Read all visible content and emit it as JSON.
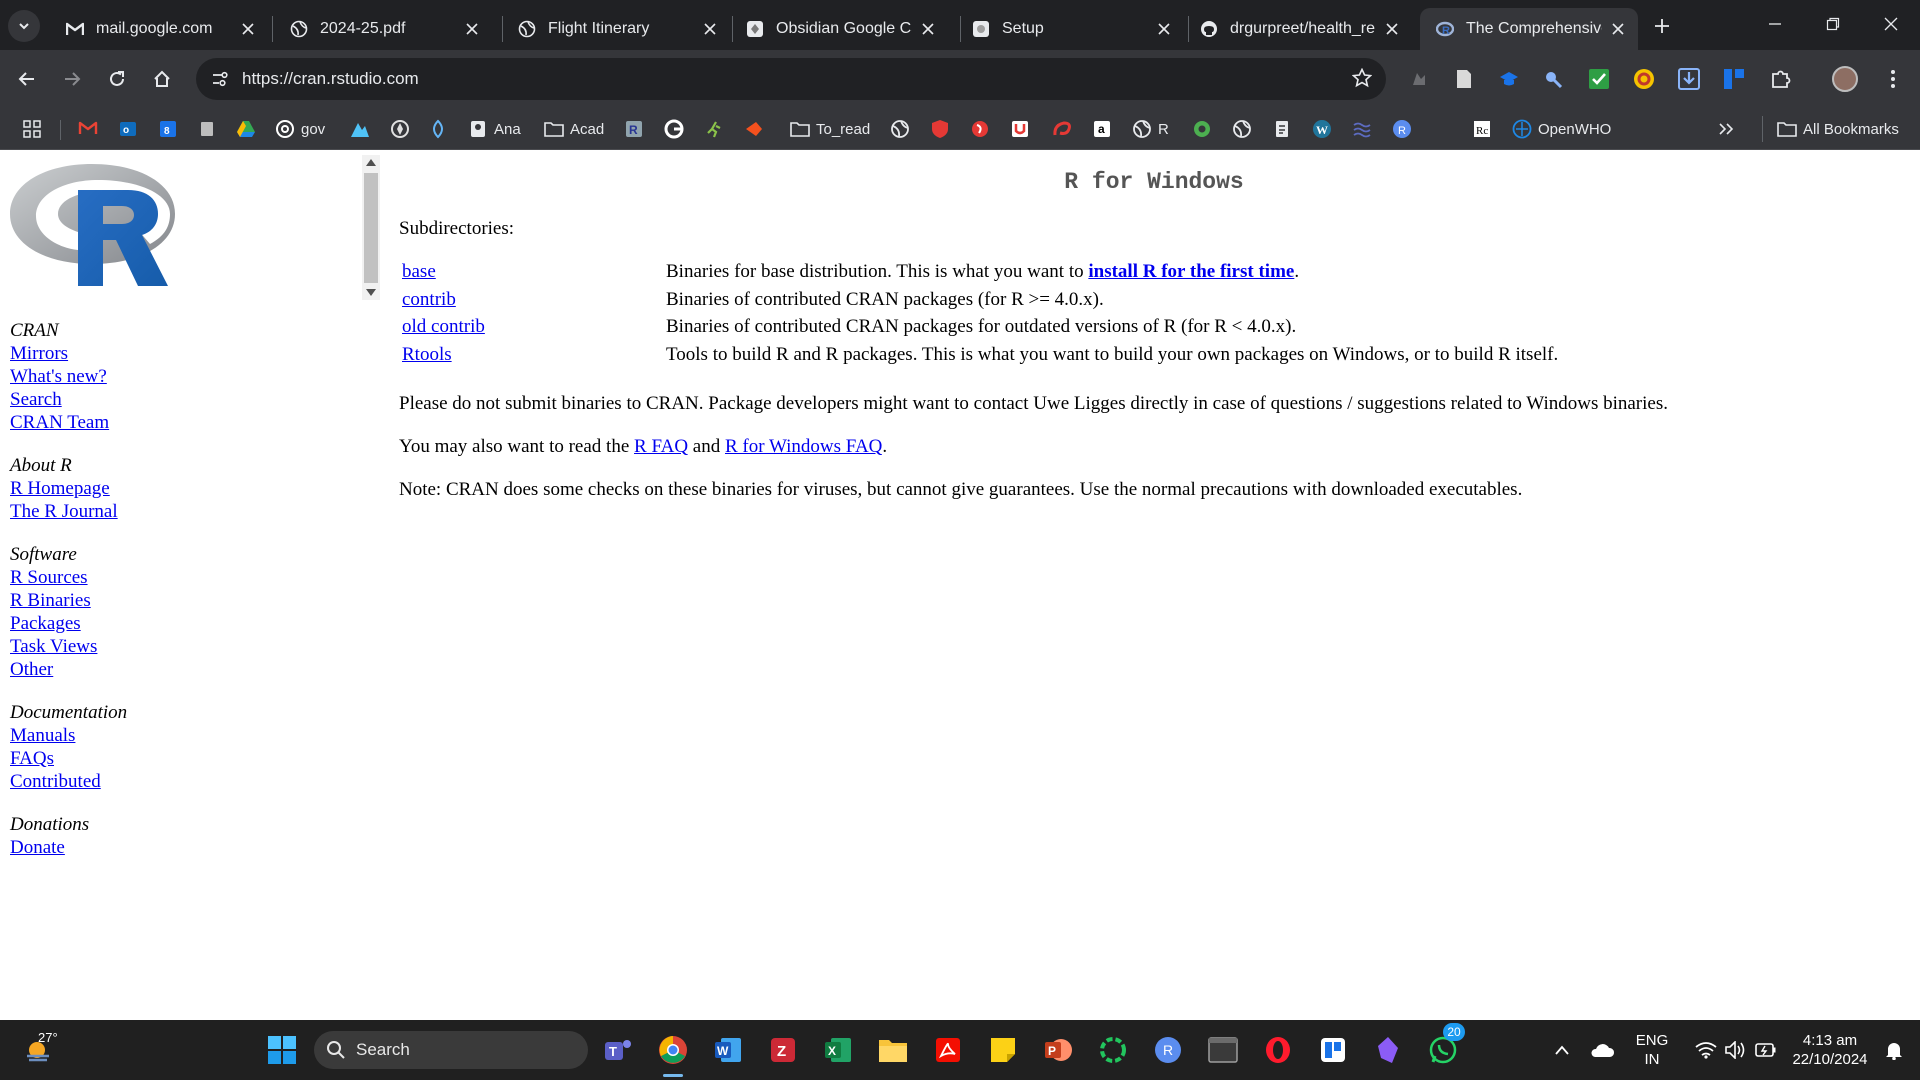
{
  "browser": {
    "tabs": [
      {
        "title": "mail.google.com",
        "icon": "gmail-icon",
        "active": false
      },
      {
        "title": "2024-25.pdf",
        "icon": "globe-icon",
        "active": false
      },
      {
        "title": "Flight Itinerary",
        "icon": "globe-icon",
        "active": false
      },
      {
        "title": "Obsidian Google Cal",
        "icon": "obsidian-icon",
        "active": false
      },
      {
        "title": "Setup",
        "icon": "setup-icon",
        "active": false
      },
      {
        "title": "drgurpreet/health_re",
        "icon": "github-icon",
        "active": false
      },
      {
        "title": "The Comprehensive R",
        "icon": "cran-icon",
        "active": true
      }
    ],
    "url": "https://cran.rstudio.com",
    "bookmarks": [
      {
        "label": "",
        "icon": "gmail-icon",
        "color": "#ea4335"
      },
      {
        "label": "",
        "icon": "outlook-icon",
        "color": "#0f6cbd"
      },
      {
        "label": "",
        "icon": "calendar-icon",
        "color": "#1a73e8"
      },
      {
        "label": "",
        "icon": "notepad-icon",
        "color": "#bdbdbd"
      },
      {
        "label": "",
        "icon": "drive-icon",
        "color": "#34a853"
      },
      {
        "label": "gov",
        "icon": "at-icon",
        "color": "#ffffff"
      },
      {
        "label": "",
        "icon": "mountain-icon",
        "color": "#4fc3f7"
      },
      {
        "label": "",
        "icon": "compass-icon",
        "color": "#e0e0e0"
      },
      {
        "label": "",
        "icon": "leaf-icon",
        "color": "#64b5f6"
      },
      {
        "label": "Ana",
        "icon": "id-card-icon",
        "color": "#e8eaed"
      },
      {
        "label": "Acad",
        "icon": "folder-icon",
        "color": "#e8eaed"
      },
      {
        "label": "",
        "icon": "r-book-icon",
        "color": "#90a4ae"
      },
      {
        "label": "",
        "icon": "google-icon",
        "color": "#ffffff"
      },
      {
        "label": "",
        "icon": "runner-icon",
        "color": "#8bc34a"
      },
      {
        "label": "",
        "icon": "arrow-icon",
        "color": "#f4511e"
      },
      {
        "label": "To_read",
        "icon": "folder-icon",
        "color": "#e8eaed"
      },
      {
        "label": "",
        "icon": "globe-icon",
        "color": "#e8eaed"
      },
      {
        "label": "",
        "icon": "shield-icon",
        "color": "#e53935"
      },
      {
        "label": "",
        "icon": "swirl-icon",
        "color": "#e53935"
      },
      {
        "label": "",
        "icon": "u-icon",
        "color": "#e53935"
      },
      {
        "label": "",
        "icon": "airtel-icon",
        "color": "#e53935"
      },
      {
        "label": "",
        "icon": "amazon-icon",
        "color": "#ffffff"
      },
      {
        "label": "R",
        "icon": "globe-icon",
        "color": "#e8eaed"
      },
      {
        "label": "",
        "icon": "o-icon",
        "color": "#4caf50"
      },
      {
        "label": "",
        "icon": "globe-icon",
        "color": "#e8eaed"
      },
      {
        "label": "",
        "icon": "doc-icon",
        "color": "#e8eaed"
      },
      {
        "label": "",
        "icon": "wordpress-icon",
        "color": "#21759b"
      },
      {
        "label": "",
        "icon": "waves-icon",
        "color": "#5c6bc0"
      },
      {
        "label": "",
        "icon": "r-circle-icon",
        "color": "#5b8def"
      },
      {
        "label": "",
        "icon": "rc-icon",
        "color": "#ffffff"
      },
      {
        "label": "OpenWHO",
        "icon": "who-icon",
        "color": "#1e88e5"
      }
    ],
    "all_bookmarks": "All Bookmarks"
  },
  "page": {
    "title": "R for Windows",
    "subdirectories_label": "Subdirectories:",
    "subdirectories": [
      {
        "name": "base",
        "desc_before": "Binaries for base distribution. This is what you want to ",
        "link": "install R for the first time",
        "desc_after": "."
      },
      {
        "name": "contrib",
        "desc_before": "Binaries of contributed CRAN packages (for R >= 4.0.x).",
        "link": "",
        "desc_after": ""
      },
      {
        "name": "old contrib",
        "desc_before": "Binaries of contributed CRAN packages for outdated versions of R (for R < 4.0.x).",
        "link": "",
        "desc_after": ""
      },
      {
        "name": "Rtools",
        "desc_before": "Tools to build R and R packages. This is what you want to build your own packages on Windows, or to build R itself.",
        "link": "",
        "desc_after": ""
      }
    ],
    "para1": "Please do not submit binaries to CRAN. Package developers might want to contact Uwe Ligges directly in case of questions / suggestions related to Windows binaries.",
    "para2": {
      "before": "You may also want to read the ",
      "link1": "R FAQ",
      "mid": " and ",
      "link2": "R for Windows FAQ",
      "after": "."
    },
    "para3": "Note: CRAN does some checks on these binaries for viruses, but cannot give guarantees. Use the normal precautions with downloaded executables."
  },
  "sidebar": {
    "groups": [
      {
        "heading": "CRAN",
        "links": [
          "Mirrors",
          "What's new?",
          "Search",
          "CRAN Team"
        ]
      },
      {
        "heading": "About R",
        "links": [
          "R Homepage",
          "The R Journal"
        ]
      },
      {
        "heading": "Software",
        "links": [
          "R Sources",
          "R Binaries",
          "Packages",
          "Task Views",
          "Other"
        ]
      },
      {
        "heading": "Documentation",
        "links": [
          "Manuals",
          "FAQs",
          "Contributed"
        ]
      },
      {
        "heading": "Donations",
        "links": [
          "Donate"
        ]
      }
    ]
  },
  "taskbar": {
    "weather": "27°",
    "search_label": "Search",
    "language": "ENG",
    "region": "IN",
    "time": "4:13 am",
    "date": "22/10/2024",
    "whatsapp_badge": "20"
  }
}
